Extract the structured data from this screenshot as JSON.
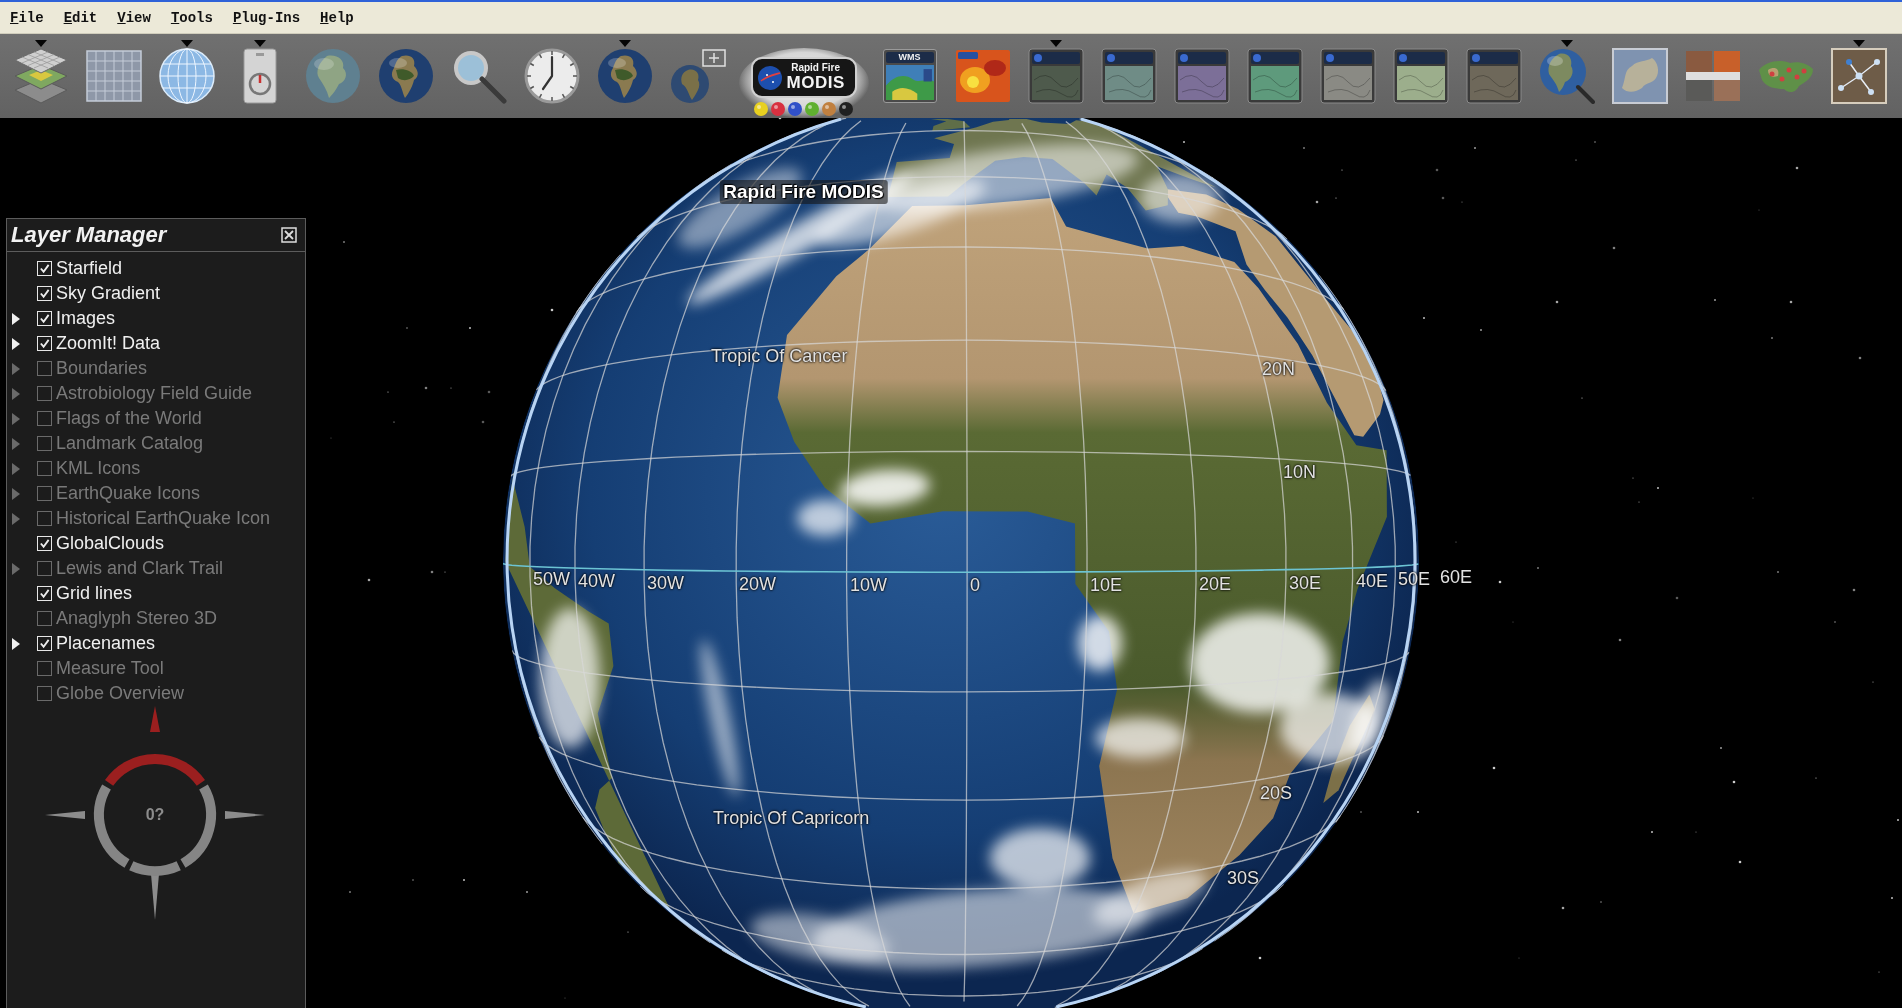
{
  "menu_bar": {
    "items": [
      "File",
      "Edit",
      "View",
      "Tools",
      "Plug-Ins",
      "Help"
    ]
  },
  "toolbar": {
    "tooltip": "Rapid Fire MODIS",
    "items": [
      {
        "kind": "layers",
        "has_menu": true,
        "hovered": false
      },
      {
        "kind": "grid",
        "has_menu": false,
        "hovered": false
      },
      {
        "kind": "wire_globe",
        "has_menu": true,
        "hovered": false
      },
      {
        "kind": "compass_card",
        "has_menu": true,
        "hovered": false
      },
      {
        "kind": "globe",
        "has_menu": false,
        "hovered": false
      },
      {
        "kind": "earth",
        "has_menu": false,
        "hovered": false
      },
      {
        "kind": "magnifier",
        "has_menu": false,
        "hovered": false
      },
      {
        "kind": "clock",
        "has_menu": false,
        "hovered": false
      },
      {
        "kind": "earth",
        "has_menu": true,
        "hovered": false
      },
      {
        "kind": "earth_plus",
        "has_menu": false,
        "hovered": false
      },
      {
        "kind": "logo",
        "has_menu": false,
        "hovered": true,
        "logo_text": [
          "Rapid Fire",
          "MODIS"
        ]
      },
      {
        "kind": "labeled_thumbnail",
        "has_menu": false,
        "hovered": false,
        "label": "WMS"
      },
      {
        "kind": "heatmap",
        "has_menu": false,
        "hovered": false
      },
      {
        "kind": "thumbnail",
        "has_menu": true,
        "hovered": false,
        "color": "#4e5a4c"
      },
      {
        "kind": "thumbnail",
        "has_menu": false,
        "hovered": false,
        "color": "#6f8c86"
      },
      {
        "kind": "thumbnail",
        "has_menu": false,
        "hovered": false,
        "color": "#7c6f98"
      },
      {
        "kind": "thumbnail",
        "has_menu": false,
        "hovered": false,
        "color": "#5e9a7c"
      },
      {
        "kind": "thumbnail",
        "has_menu": false,
        "hovered": false,
        "color": "#8a8a84"
      },
      {
        "kind": "thumbnail",
        "has_menu": false,
        "hovered": false,
        "color": "#9cae8c"
      },
      {
        "kind": "thumbnail",
        "has_menu": false,
        "hovered": false,
        "color": "#6e685a"
      },
      {
        "kind": "globe_search",
        "has_menu": true,
        "hovered": false
      },
      {
        "kind": "map",
        "has_menu": false,
        "hovered": false
      },
      {
        "kind": "photo_tiles",
        "has_menu": false,
        "hovered": false
      },
      {
        "kind": "country_map",
        "has_menu": false,
        "hovered": false
      },
      {
        "kind": "network",
        "has_menu": true,
        "hovered": false
      }
    ]
  },
  "globe": {
    "grid_labels": [
      "Tropic Of Cancer",
      "20N",
      "10N",
      "50W",
      "40W",
      "30W",
      "20W",
      "10W",
      "0",
      "10E",
      "20E",
      "30E",
      "40E",
      "50E",
      "60E",
      "20S",
      "30S",
      "Tropic Of Capricorn"
    ]
  },
  "layer_manager": {
    "title": "Layer Manager",
    "layers": [
      {
        "name": "Starfield",
        "kind": "layer",
        "checked": true
      },
      {
        "name": "Sky Gradient",
        "kind": "layer",
        "checked": true
      },
      {
        "name": "Images",
        "kind": "folder",
        "checked": true
      },
      {
        "name": "ZoomIt! Data",
        "kind": "folder",
        "checked": true
      },
      {
        "name": "Boundaries",
        "kind": "folder",
        "checked": false
      },
      {
        "name": "Astrobiology Field Guide",
        "kind": "folder",
        "checked": false
      },
      {
        "name": "Flags of the World",
        "kind": "folder",
        "checked": false
      },
      {
        "name": "Landmark Catalog",
        "kind": "folder",
        "checked": false
      },
      {
        "name": "KML Icons",
        "kind": "folder",
        "checked": false
      },
      {
        "name": "EarthQuake Icons",
        "kind": "folder",
        "checked": false
      },
      {
        "name": "Historical EarthQuake Icon",
        "kind": "folder",
        "checked": false
      },
      {
        "name": "GlobalClouds",
        "kind": "layer",
        "checked": true
      },
      {
        "name": "Lewis and Clark Trail",
        "kind": "folder",
        "checked": false
      },
      {
        "name": "Grid lines",
        "kind": "layer",
        "checked": true
      },
      {
        "name": "Anaglyph Stereo 3D",
        "kind": "layer",
        "checked": false
      },
      {
        "name": "Placenames",
        "kind": "folder",
        "checked": true
      },
      {
        "name": "Measure Tool",
        "kind": "layer",
        "checked": false
      },
      {
        "name": "Globe Overview",
        "kind": "layer",
        "checked": false
      }
    ]
  },
  "compass": {
    "heading": "0?"
  }
}
